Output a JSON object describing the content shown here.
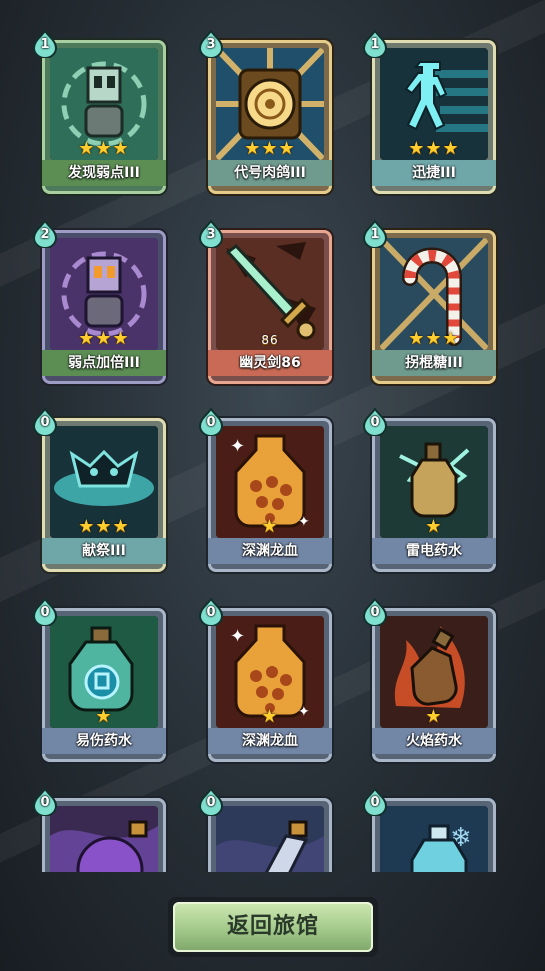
{
  "colors": {
    "star": "#ffcd2e",
    "badge": "#7fe0cf",
    "button": "#a3c98a"
  },
  "cards": [
    {
      "cost": "1",
      "label": "发现弱点III",
      "stars": "★★★",
      "tier": "green",
      "icon": "target-robot-icon"
    },
    {
      "cost": "3",
      "label": "代号肉鸽III",
      "stars": "★★★",
      "tier": "gold",
      "icon": "golden-disc-icon"
    },
    {
      "cost": "1",
      "label": "迅捷III",
      "stars": "★★★",
      "tier": "cream",
      "icon": "running-figure-icon"
    },
    {
      "cost": "2",
      "label": "弱点加倍III",
      "stars": "★★★",
      "tier": "purple",
      "icon": "purple-robot-icon"
    },
    {
      "cost": "3",
      "label": "幽灵剑86",
      "stars": "86",
      "tier": "red",
      "icon": "ghost-sword-icon"
    },
    {
      "cost": "1",
      "label": "拐棍糖III",
      "stars": "★★★",
      "tier": "gold",
      "icon": "candy-cane-icon"
    },
    {
      "cost": "0",
      "label": "献祭III",
      "stars": "★★★",
      "tier": "cream",
      "icon": "sacrifice-skull-icon"
    },
    {
      "cost": "0",
      "label": "深渊龙血",
      "stars": "★",
      "tier": "blue",
      "icon": "dragon-blood-flask-icon"
    },
    {
      "cost": "0",
      "label": "雷电药水",
      "stars": "★",
      "tier": "blue",
      "icon": "lightning-potion-icon"
    },
    {
      "cost": "0",
      "label": "易伤药水",
      "stars": "★",
      "tier": "blue",
      "icon": "vulnerability-potion-icon"
    },
    {
      "cost": "0",
      "label": "深渊龙血",
      "stars": "★",
      "tier": "blue",
      "icon": "dragon-blood-flask-icon"
    },
    {
      "cost": "0",
      "label": "火焰药水",
      "stars": "★",
      "tier": "blue",
      "icon": "fire-potion-icon"
    },
    {
      "cost": "0",
      "label": "",
      "stars": "",
      "tier": "blue",
      "icon": "purple-potion-icon"
    },
    {
      "cost": "0",
      "label": "",
      "stars": "",
      "tier": "blue",
      "icon": "bottle-icon"
    },
    {
      "cost": "0",
      "label": "",
      "stars": "",
      "tier": "blue",
      "icon": "ice-potion-icon"
    }
  ],
  "return_button": {
    "label": "返回旅馆"
  }
}
